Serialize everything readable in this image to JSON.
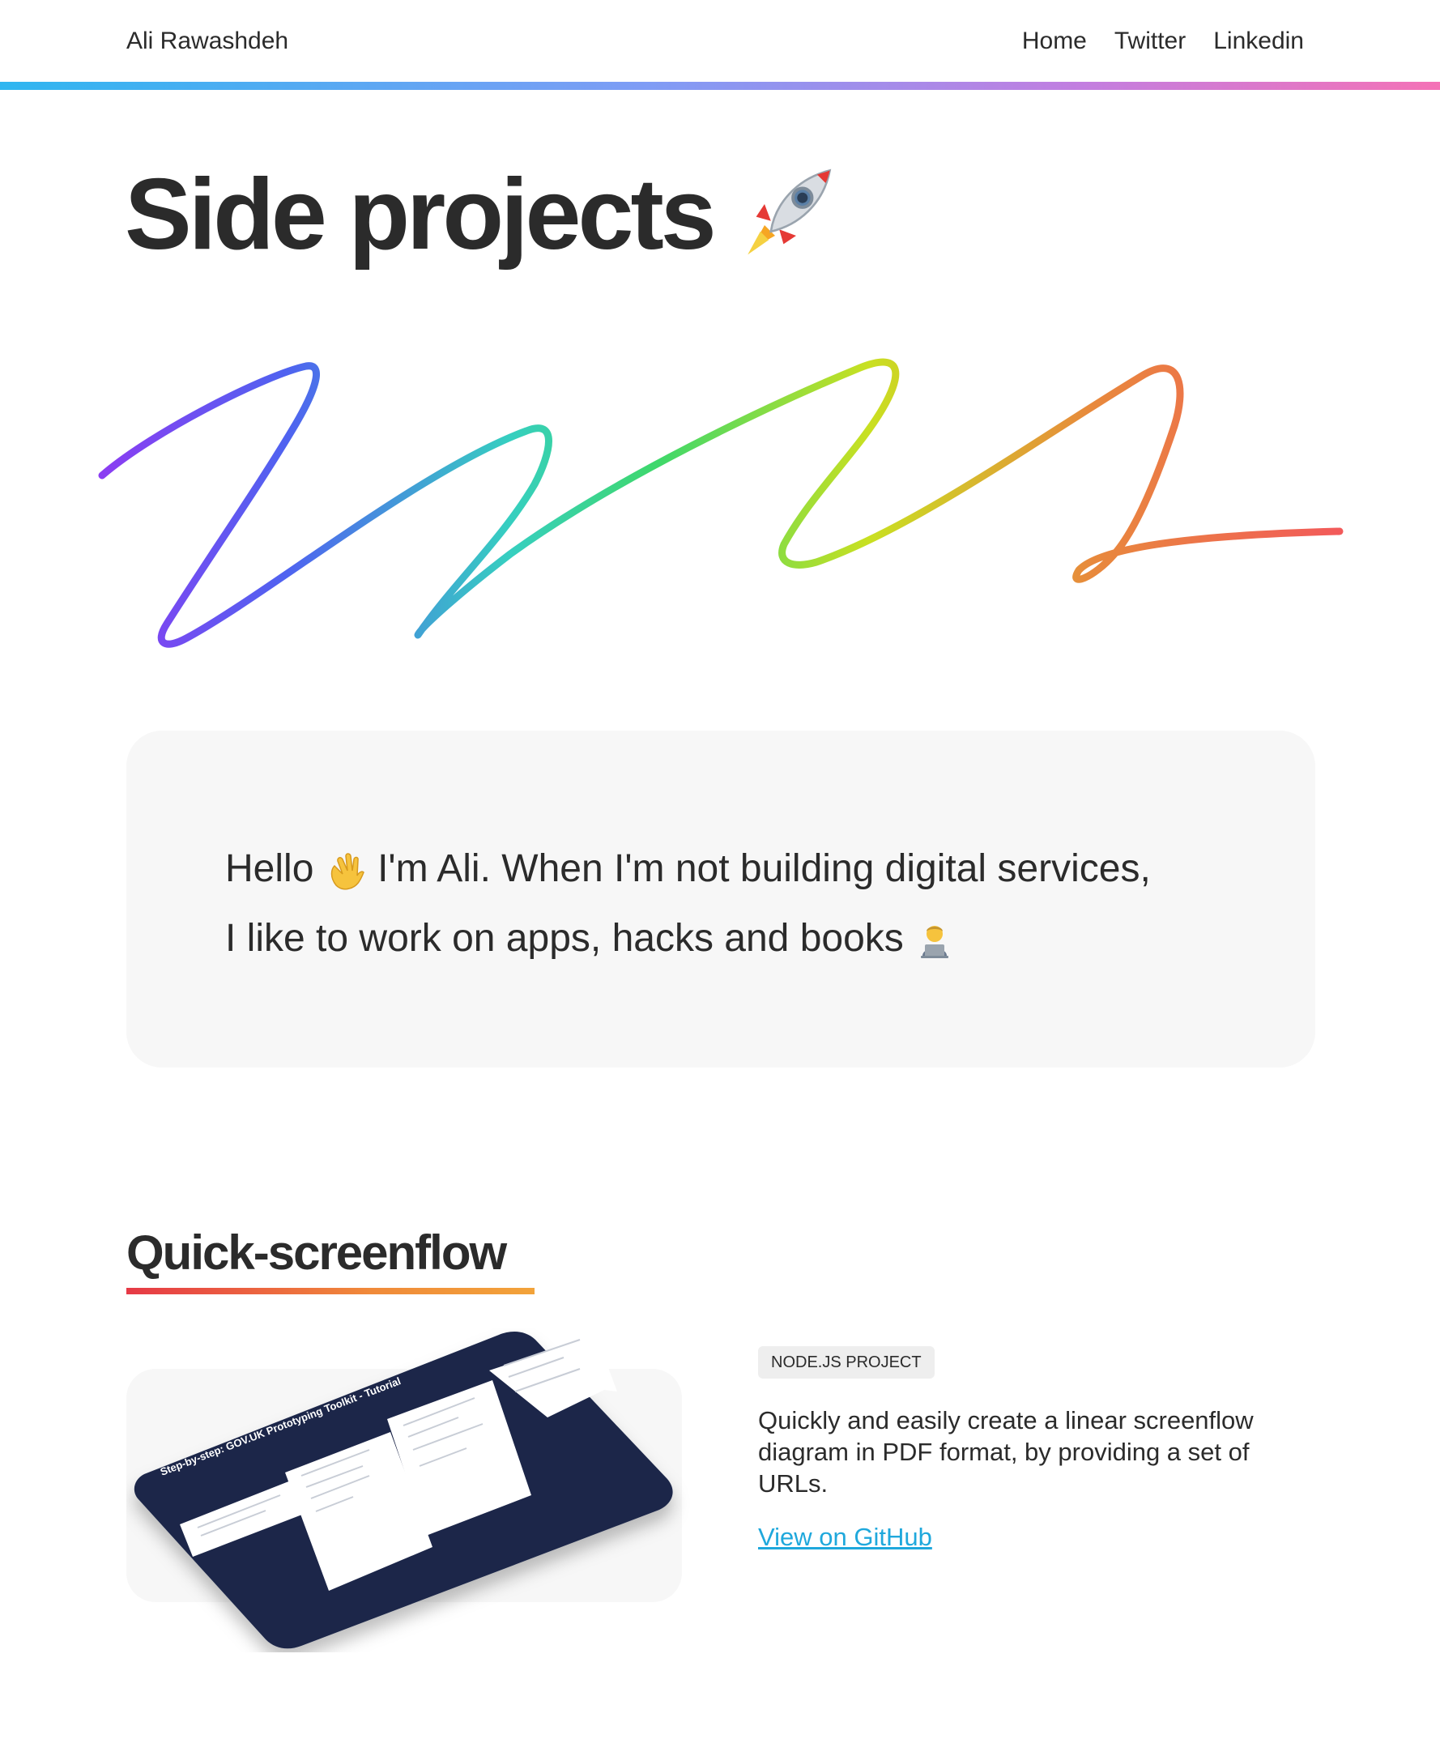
{
  "header": {
    "site_name": "Ali Rawashdeh",
    "nav": [
      {
        "label": "Home"
      },
      {
        "label": "Twitter"
      },
      {
        "label": "Linkedin"
      }
    ]
  },
  "page": {
    "title": "Side projects",
    "title_emoji": "rocket-icon"
  },
  "intro": {
    "line1_a": "Hello",
    "line1_b": "I'm Ali. When I'm not building digital services,",
    "line2": "I like to work on apps, hacks and books",
    "emojis": [
      "waving-hand-icon",
      "technologist-icon"
    ]
  },
  "project": {
    "title": "Quick-screenflow",
    "tag": "NODE.JS PROJECT",
    "description": "Quickly and easily create a linear screenflow diagram in PDF format, by providing a set of URLs.",
    "link_label": "View on GitHub",
    "image_caption": "Step-by-step: GOV.UK Prototyping Toolkit - Tutorial"
  },
  "colors": {
    "text": "#2b2b2b",
    "link": "#1fa8dc",
    "card_bg": "#f7f7f7",
    "tag_bg": "#eeeeee",
    "device_navy": "#1a2649"
  }
}
